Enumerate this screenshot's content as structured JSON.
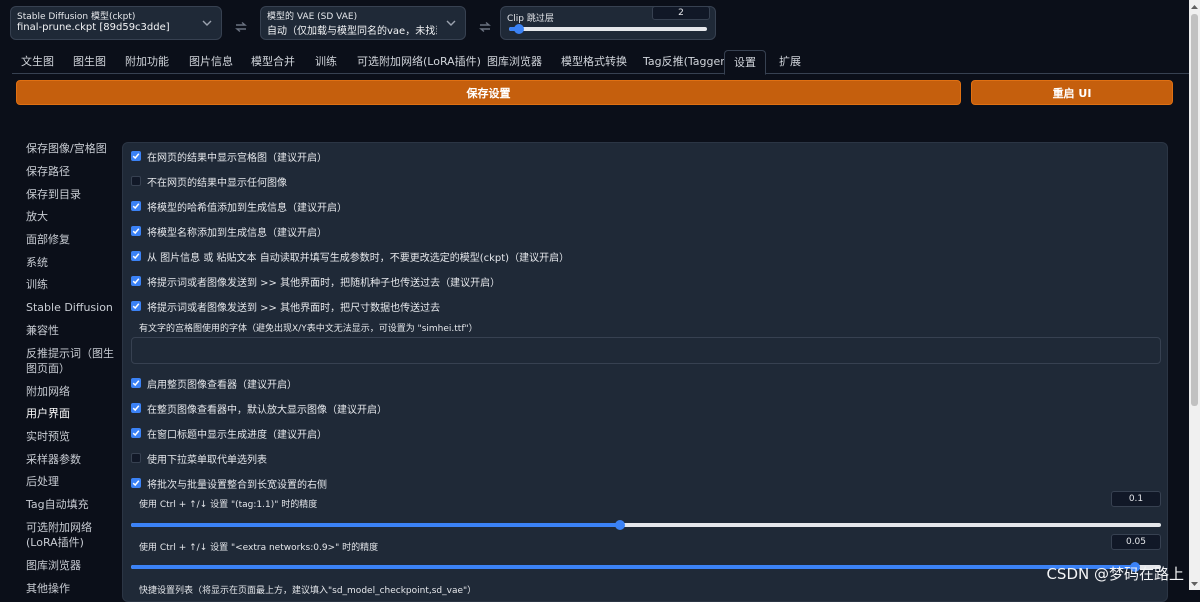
{
  "topbar": {
    "checkpoint": {
      "label": "Stable Diffusion 模型(ckpt)",
      "value": "final-prune.ckpt [89d59c3dde]"
    },
    "vae": {
      "label": "模型的 VAE (SD VAE)",
      "value": "自动（仅加载与模型同名的vae，未找到则不加"
    },
    "clip_skip": {
      "label": "Clip 跳过层",
      "value": "2",
      "fraction": 0.05
    }
  },
  "tabs": [
    "文生图",
    "图生图",
    "附加功能",
    "图片信息",
    "模型合并",
    "训练",
    "可选附加网络(LoRA插件)",
    "图库浏览器",
    "模型格式转换",
    "Tag反推(Tagger)",
    "设置",
    "扩展"
  ],
  "active_tab": "设置",
  "buttons": {
    "save": "保存设置",
    "restart": "重启 UI"
  },
  "sidebar": [
    "保存图像/宫格图",
    "保存路径",
    "保存到目录",
    "放大",
    "面部修复",
    "系统",
    "训练",
    "Stable Diffusion",
    "兼容性",
    "反推提示词（图生图页面）",
    "附加网络",
    "用户界面",
    "实时预览",
    "采样器参数",
    "后处理",
    "Tag自动填充",
    "可选附加网络(LoRA插件)",
    "图库浏览器",
    "其他操作"
  ],
  "sidebar_current": "用户界面",
  "settings": {
    "group1": [
      {
        "label": "在网页的结果中显示宫格图（建议开启）",
        "checked": true
      },
      {
        "label": "不在网页的结果中显示任何图像",
        "checked": false
      },
      {
        "label": "将模型的哈希值添加到生成信息（建议开启）",
        "checked": true
      },
      {
        "label": "将模型名称添加到生成信息（建议开启）",
        "checked": true
      },
      {
        "label": "从 图片信息 或 粘贴文本 自动读取并填写生成参数时，不要更改选定的模型(ckpt)（建议开启）",
        "checked": true
      },
      {
        "label": "将提示词或者图像发送到 >> 其他界面时，把随机种子也传送过去（建议开启）",
        "checked": true
      },
      {
        "label": "将提示词或者图像发送到 >> 其他界面时，把尺寸数据也传送过去",
        "checked": true
      }
    ],
    "font_field": {
      "label": "有文字的宫格图使用的字体（避免出现X/Y表中文无法显示，可设置为 \"simhei.ttf\"）",
      "value": ""
    },
    "group2": [
      {
        "label": "启用整页图像查看器（建议开启）",
        "checked": true
      },
      {
        "label": "在整页图像查看器中，默认放大显示图像（建议开启）",
        "checked": true
      },
      {
        "label": "在窗口标题中显示生成进度（建议开启）",
        "checked": true
      },
      {
        "label": "使用下拉菜单取代单选列表",
        "checked": false
      },
      {
        "label": "将批次与批量设置整合到长宽设置的右侧",
        "checked": true
      }
    ],
    "slider1": {
      "label": "使用 Ctrl + ↑/↓ 设置 \"(tag:1.1)\" 时的精度",
      "value": "0.1",
      "fraction": 0.475
    },
    "slider2": {
      "label": "使用 Ctrl + ↑/↓ 设置 \"<extra networks:0.9>\" 时的精度",
      "value": "0.05",
      "fraction": 0.975
    },
    "quick_list_label": "快捷设置列表（将显示在页面最上方，建议填入\"sd_model_checkpoint,sd_vae\"）"
  },
  "watermark": "CSDN @梦码在路上",
  "colors": {
    "accent": "#3b82f6",
    "orange": "#c55f0d",
    "panel": "#1f2937",
    "background": "#0b0f19"
  }
}
